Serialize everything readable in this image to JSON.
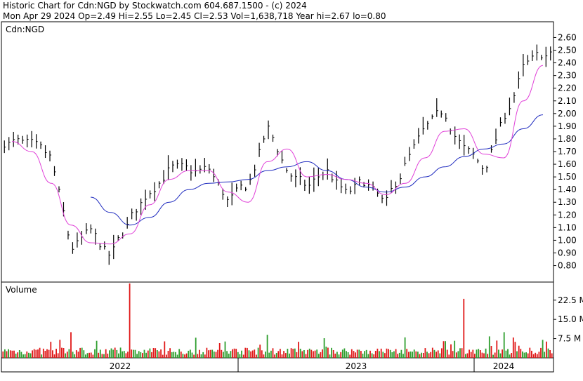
{
  "header": {
    "line1": "Historic Chart for Cdn:NGD by Stockwatch.com 604.687.1500 - (c) 2024",
    "line2": "Mon Apr 29 2024  Op=2.49  Hi=2.55  Lo=2.45  Cl=2.53  Vol=1,638,718  Year hi=2.67  lo=0.80"
  },
  "colors": {
    "price_bar": "#000000",
    "ma_short": "#e040d8",
    "ma_long": "#1f2bbf",
    "volume_up": "#2e9e2e",
    "volume_down": "#e01818",
    "frame": "#000000"
  },
  "chart_data": [
    {
      "type": "ohlc",
      "title": "Cdn:NGD",
      "ylim": [
        0.72,
        2.68
      ],
      "y_ticks": [
        "2.60",
        "2.50",
        "2.40",
        "2.30",
        "2.20",
        "2.10",
        "2.00",
        "1.90",
        "1.80",
        "1.70",
        "1.60",
        "1.50",
        "1.40",
        "1.30",
        "1.20",
        "1.10",
        "1.00",
        "0.90",
        "0.80"
      ],
      "x_labels": [
        "2022",
        "2023",
        "2024"
      ],
      "x_range": [
        "2022-01",
        "2024-04"
      ],
      "series": [
        {
          "type": "close",
          "x": [
            "2022-01",
            "2022-02",
            "2022-03",
            "2022-04",
            "2022-05",
            "2022-06",
            "2022-07",
            "2022-08",
            "2022-09",
            "2022-10",
            "2022-11",
            "2022-12",
            "2023-01",
            "2023-02",
            "2023-03",
            "2023-04",
            "2023-05",
            "2023-06",
            "2023-07",
            "2023-08",
            "2023-09",
            "2023-10",
            "2023-11",
            "2023-12",
            "2024-01",
            "2024-02",
            "2024-03",
            "2024-04"
          ],
          "values": [
            1.78,
            1.72,
            1.62,
            0.92,
            1.05,
            0.85,
            1.15,
            1.4,
            1.58,
            1.52,
            1.55,
            1.3,
            1.42,
            1.88,
            1.55,
            1.4,
            1.55,
            1.35,
            1.45,
            1.25,
            1.6,
            1.85,
            2.0,
            1.72,
            1.55,
            1.95,
            2.35,
            2.45
          ]
        },
        {
          "name": "",
          "type": "moving-average-short",
          "x": [
            "2022-01",
            "2022-02",
            "2022-03",
            "2022-04",
            "2022-05",
            "2022-06",
            "2022-07",
            "2022-08",
            "2022-09",
            "2022-10",
            "2022-11",
            "2022-12",
            "2023-01",
            "2023-02",
            "2023-03",
            "2023-04",
            "2023-05",
            "2023-06",
            "2023-07",
            "2023-08",
            "2023-09",
            "2023-10",
            "2023-11",
            "2023-12",
            "2024-01",
            "2024-02",
            "2024-03",
            "2024-04"
          ],
          "values": [
            1.78,
            1.7,
            1.45,
            1.12,
            0.98,
            0.97,
            1.05,
            1.28,
            1.48,
            1.55,
            1.55,
            1.38,
            1.3,
            1.62,
            1.72,
            1.5,
            1.52,
            1.48,
            1.45,
            1.36,
            1.45,
            1.65,
            1.86,
            1.88,
            1.68,
            1.65,
            2.1,
            2.38
          ]
        },
        {
          "name": "",
          "type": "moving-average-long",
          "x": [
            "2022-05",
            "2022-06",
            "2022-07",
            "2022-08",
            "2022-09",
            "2022-10",
            "2022-11",
            "2022-12",
            "2023-01",
            "2023-02",
            "2023-03",
            "2023-04",
            "2023-05",
            "2023-06",
            "2023-07",
            "2023-08",
            "2023-09",
            "2023-10",
            "2023-11",
            "2023-12",
            "2024-01",
            "2024-02",
            "2024-03",
            "2024-04"
          ],
          "values": [
            1.34,
            1.22,
            1.12,
            1.18,
            1.3,
            1.4,
            1.45,
            1.46,
            1.48,
            1.55,
            1.58,
            1.62,
            1.55,
            1.48,
            1.42,
            1.38,
            1.42,
            1.5,
            1.58,
            1.66,
            1.72,
            1.76,
            1.88,
            1.99
          ]
        }
      ]
    },
    {
      "type": "bar",
      "title": "Volume",
      "ylim": [
        0,
        29
      ],
      "y_ticks": [
        "22.5 M",
        "15.0 M",
        "7.5 M"
      ],
      "x": [
        "2022-01",
        "2022-02",
        "2022-03",
        "2022-04",
        "2022-05",
        "2022-06",
        "2022-07",
        "2022-08",
        "2022-09",
        "2022-10",
        "2022-11",
        "2022-12",
        "2023-01",
        "2023-02",
        "2023-03",
        "2023-04",
        "2023-05",
        "2023-06",
        "2023-07",
        "2023-08",
        "2023-09",
        "2023-10",
        "2023-11",
        "2023-12",
        "2024-01",
        "2024-02",
        "2024-03",
        "2024-04"
      ],
      "values": [
        3.5,
        4.0,
        3.2,
        10.0,
        3.5,
        4.0,
        29.0,
        4.5,
        4.0,
        3.5,
        3.5,
        4.0,
        3.5,
        9.0,
        4.5,
        3.5,
        3.8,
        3.2,
        3.5,
        4.0,
        8.0,
        5.0,
        6.5,
        23.0,
        4.5,
        10.0,
        6.0,
        7.0
      ]
    }
  ]
}
